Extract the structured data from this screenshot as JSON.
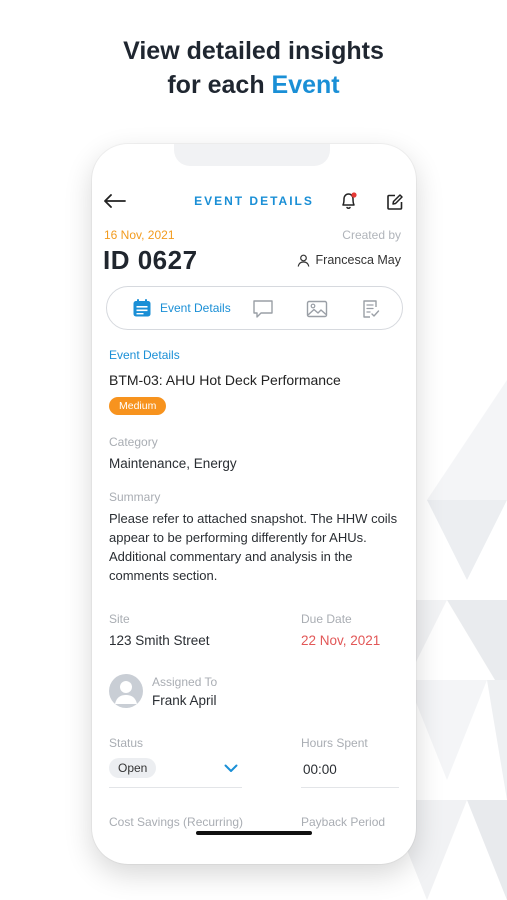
{
  "promo": {
    "line1": "View detailed insights",
    "line2_prefix": "for each ",
    "line2_accent": "Event"
  },
  "header": {
    "title": "EVENT DETAILS",
    "back_icon": "back-arrow-icon",
    "notify_icon": "bell-alert-icon",
    "edit_icon": "edit-icon"
  },
  "meta": {
    "date": "16 Nov, 2021",
    "created_by_label": "Created by",
    "id": "ID 0627",
    "creator": "Francesca May"
  },
  "tabs": [
    {
      "label": "Event Details",
      "icon": "calendar-icon",
      "active": true
    },
    {
      "label": "",
      "icon": "comment-icon",
      "active": false
    },
    {
      "label": "",
      "icon": "image-icon",
      "active": false
    },
    {
      "label": "",
      "icon": "checklist-icon",
      "active": false
    }
  ],
  "details": {
    "section_label": "Event Details",
    "event_name": "BTM-03: AHU Hot Deck Performance",
    "priority": "Medium",
    "category_label": "Category",
    "category": "Maintenance, Energy",
    "summary_label": "Summary",
    "summary": "Please refer to attached snapshot. The HHW coils appear to be performing differently for AHUs. Additional commentary and analysis in the comments section.",
    "site_label": "Site",
    "site": "123 Smith Street",
    "due_label": "Due Date",
    "due": "22 Nov, 2021",
    "assigned_label": "Assigned To",
    "assigned": "Frank April",
    "status_label": "Status",
    "status": "Open",
    "hours_label": "Hours Spent",
    "hours": "00:00",
    "cost_label": "Cost Savings (Recurring)",
    "payback_label": "Payback Period"
  },
  "colors": {
    "accent": "#1a8fd6",
    "date": "#f29b1e",
    "priority": "#f7931e",
    "due": "#e25757"
  }
}
